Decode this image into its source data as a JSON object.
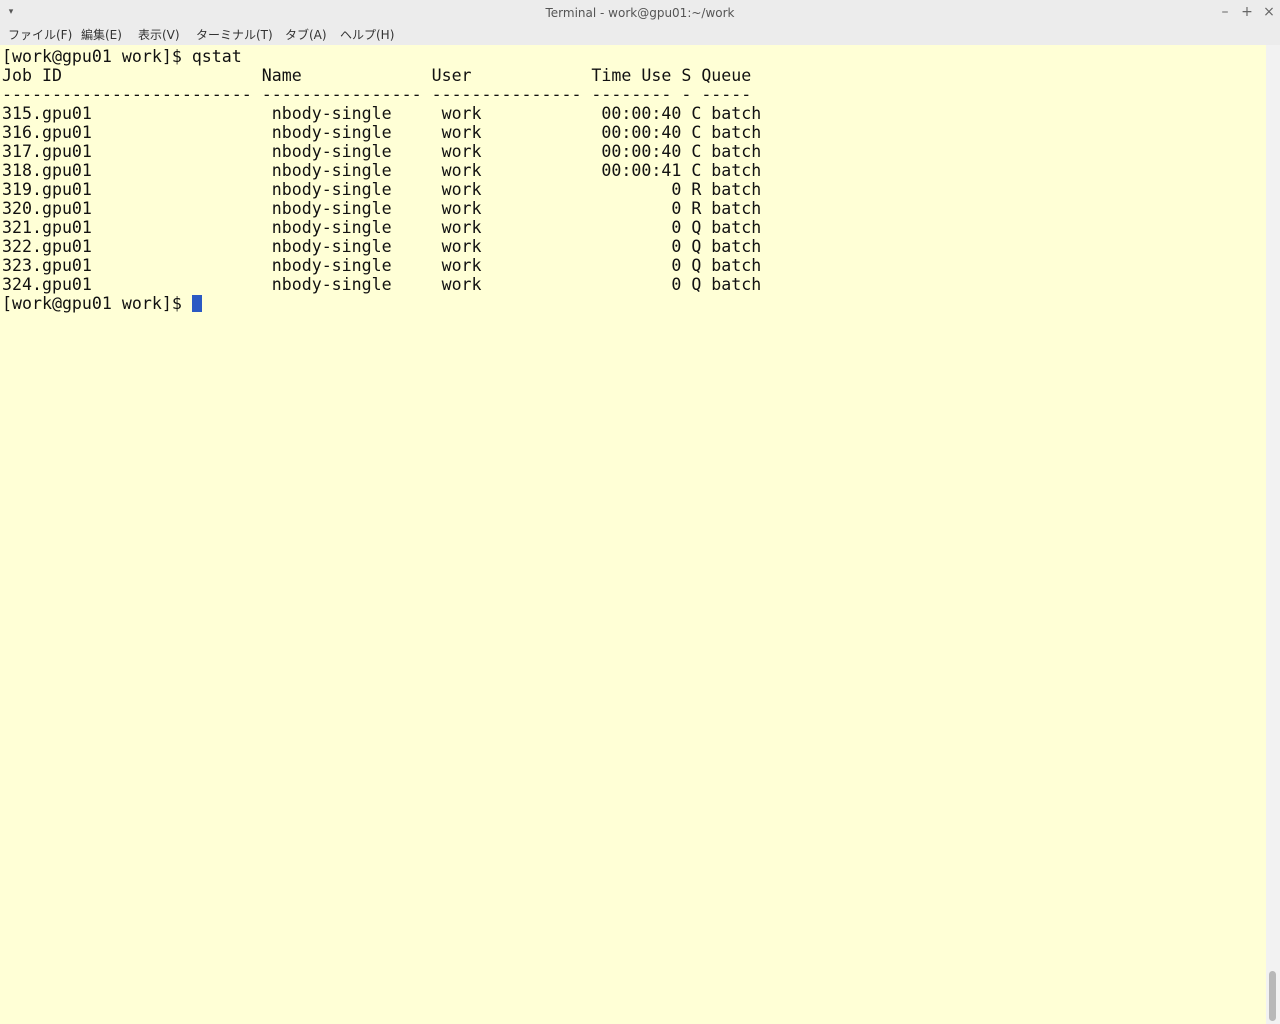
{
  "window": {
    "title": "Terminal - work@gpu01:~/work",
    "menu_arrow": "▾",
    "minimize": "–",
    "maximize": "+",
    "close": "×"
  },
  "menubar": {
    "items": [
      {
        "label": "ファイル(F)"
      },
      {
        "label": "編集(E)"
      },
      {
        "label": "表示(V)"
      },
      {
        "label": "ターミナル(T)"
      },
      {
        "label": "タブ(A)"
      },
      {
        "label": "ヘルプ(H)"
      }
    ]
  },
  "terminal": {
    "command_line": "[work@gpu01 work]$ qstat",
    "header": "Job ID                    Name             User            Time Use S Queue",
    "separator": "------------------------- ---------------- --------------- -------- - -----",
    "rows": [
      "315.gpu01                  nbody-single     work            00:00:40 C batch",
      "316.gpu01                  nbody-single     work            00:00:40 C batch",
      "317.gpu01                  nbody-single     work            00:00:40 C batch",
      "318.gpu01                  nbody-single     work            00:00:41 C batch",
      "319.gpu01                  nbody-single     work                   0 R batch",
      "320.gpu01                  nbody-single     work                   0 R batch",
      "321.gpu01                  nbody-single     work                   0 Q batch",
      "322.gpu01                  nbody-single     work                   0 Q batch",
      "323.gpu01                  nbody-single     work                   0 Q batch",
      "324.gpu01                  nbody-single     work                   0 Q batch"
    ],
    "prompt": "[work@gpu01 work]$ "
  },
  "colors": {
    "terminal_background": "#ffffd6",
    "cursor": "#2b59c3",
    "text": "#111111"
  }
}
